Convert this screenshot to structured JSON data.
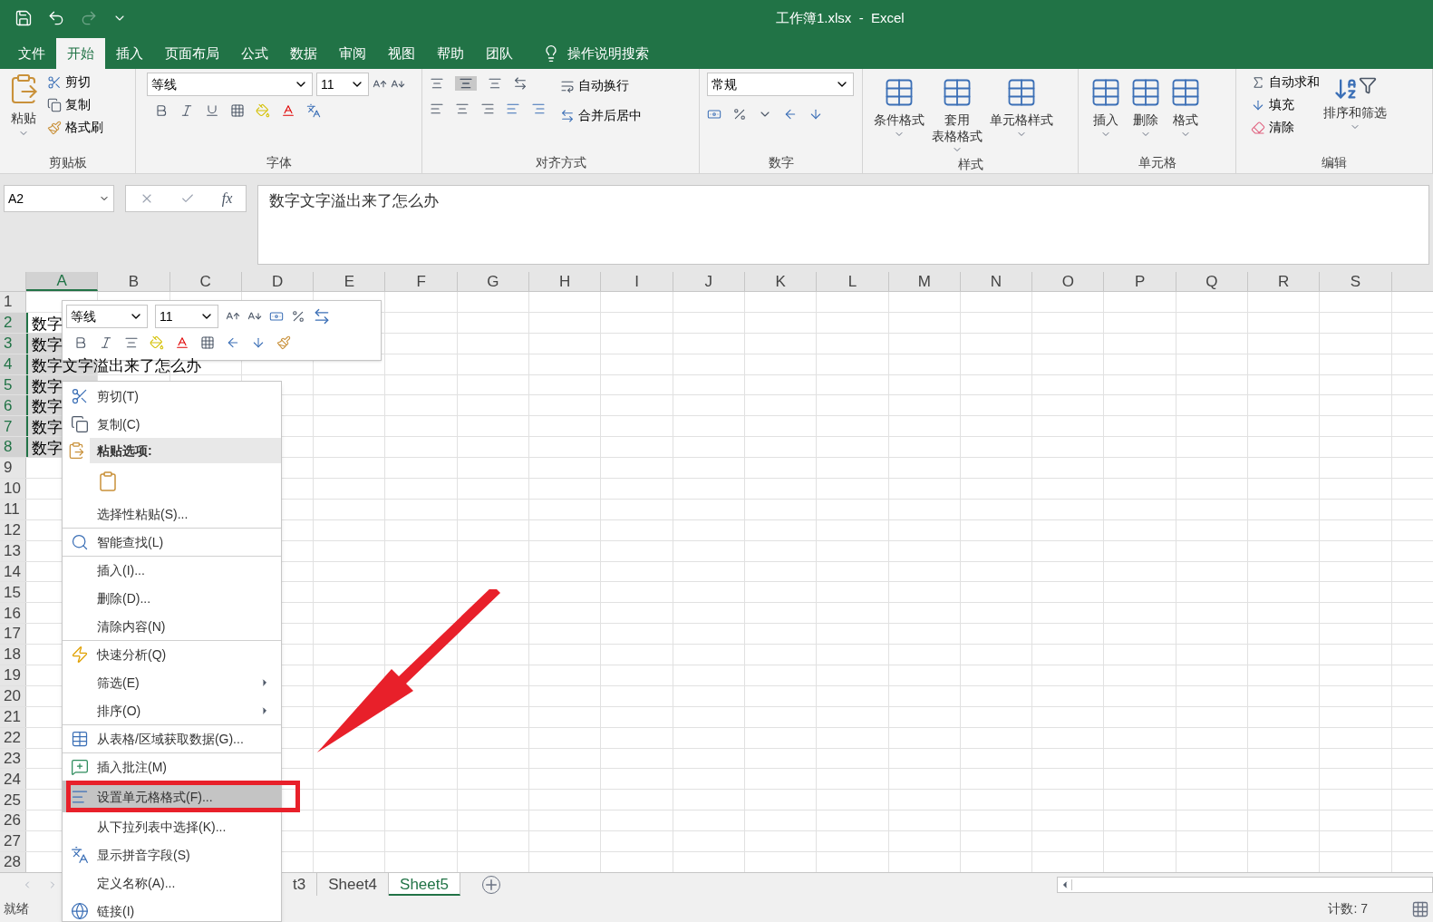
{
  "window": {
    "title": "工作簿1.xlsx  -  Excel"
  },
  "tabs": [
    {
      "label": "文件",
      "selected": false
    },
    {
      "label": "开始",
      "selected": true
    },
    {
      "label": "插入",
      "selected": false
    },
    {
      "label": "页面布局",
      "selected": false
    },
    {
      "label": "公式",
      "selected": false
    },
    {
      "label": "数据",
      "selected": false
    },
    {
      "label": "审阅",
      "selected": false
    },
    {
      "label": "视图",
      "selected": false
    },
    {
      "label": "帮助",
      "selected": false
    },
    {
      "label": "团队",
      "selected": false
    }
  ],
  "tell_me": {
    "placeholder": "操作说明搜索"
  },
  "ribbon": {
    "clipboard": {
      "paste": "粘贴",
      "cut": "剪切",
      "copy": "复制",
      "painter": "格式刷",
      "label": "剪贴板"
    },
    "font": {
      "name": "等线",
      "size": "11",
      "label": "字体"
    },
    "alignment": {
      "wrap": "自动换行",
      "merge": "合并后居中",
      "label": "对齐方式"
    },
    "number": {
      "format": "常规",
      "label": "数字"
    },
    "styles": {
      "items": [
        [
          "条件格式"
        ],
        [
          "套用",
          "表格格式"
        ],
        [
          "单元格样式"
        ]
      ],
      "label": "样式"
    },
    "cells": {
      "items": [
        "插入",
        "删除",
        "格式"
      ],
      "label": "单元格"
    },
    "editing": {
      "autosum": "自动求和",
      "fill": "填充",
      "clear": "清除",
      "sort": "排序和筛选",
      "label": "编辑"
    }
  },
  "formula_bar": {
    "name_box": "A2",
    "fx": "fx",
    "value": "数字文字溢出来了怎么办"
  },
  "grid": {
    "columns": [
      "A",
      "B",
      "C",
      "D",
      "E",
      "F",
      "G",
      "H",
      "I",
      "J",
      "K",
      "L",
      "M",
      "N",
      "O",
      "P",
      "Q",
      "R",
      "S"
    ],
    "rows": [
      {
        "label": "1"
      },
      {
        "label": "2",
        "a": "数字",
        "active": true
      },
      {
        "label": "3",
        "a": "数字",
        "active": false
      },
      {
        "label": "4",
        "a": "数字文字溢出来了怎么办",
        "active": false
      },
      {
        "label": "5",
        "a": "数字",
        "active": false
      },
      {
        "label": "6",
        "a": "数字",
        "active": false
      },
      {
        "label": "7",
        "a": "数字",
        "active": false
      },
      {
        "label": "8",
        "a": "数字",
        "active": false
      },
      {
        "label": "9"
      },
      {
        "label": "10"
      },
      {
        "label": "11"
      },
      {
        "label": "12"
      },
      {
        "label": "13"
      },
      {
        "label": "14"
      },
      {
        "label": "15"
      },
      {
        "label": "16"
      },
      {
        "label": "17"
      },
      {
        "label": "18"
      },
      {
        "label": "19"
      },
      {
        "label": "20"
      },
      {
        "label": "21"
      },
      {
        "label": "22"
      },
      {
        "label": "23"
      },
      {
        "label": "24"
      },
      {
        "label": "25"
      },
      {
        "label": "26"
      },
      {
        "label": "27"
      },
      {
        "label": "28"
      }
    ]
  },
  "mini_toolbar": {
    "font": "等线",
    "size": "11"
  },
  "context_menu": [
    {
      "label": "剪切(T)",
      "kind": "item",
      "selected": false,
      "submenu": false,
      "separator_before": false
    },
    {
      "label": "复制(C)",
      "kind": "item",
      "selected": false,
      "submenu": false,
      "separator_before": false
    },
    {
      "label": "粘贴选项:",
      "kind": "header"
    },
    {
      "kind": "paste_option"
    },
    {
      "label": "选择性粘贴(S)...",
      "kind": "item",
      "selected": false,
      "submenu": false,
      "separator_before": false
    },
    {
      "label": "智能查找(L)",
      "kind": "item",
      "selected": false,
      "submenu": false,
      "separator_before": true
    },
    {
      "label": "插入(I)...",
      "kind": "item",
      "selected": false,
      "submenu": false,
      "separator_before": true
    },
    {
      "label": "删除(D)...",
      "kind": "item",
      "selected": false,
      "submenu": false,
      "separator_before": false
    },
    {
      "label": "清除内容(N)",
      "kind": "item",
      "selected": false,
      "submenu": false,
      "separator_before": false
    },
    {
      "label": "快速分析(Q)",
      "kind": "item",
      "selected": false,
      "submenu": false,
      "separator_before": true
    },
    {
      "label": "筛选(E)",
      "kind": "item",
      "selected": false,
      "submenu": true,
      "separator_before": false
    },
    {
      "label": "排序(O)",
      "kind": "item",
      "selected": false,
      "submenu": true,
      "separator_before": false
    },
    {
      "label": "从表格/区域获取数据(G)...",
      "kind": "item",
      "selected": false,
      "submenu": false,
      "separator_before": true
    },
    {
      "label": "插入批注(M)",
      "kind": "item",
      "selected": false,
      "submenu": false,
      "separator_before": true
    },
    {
      "label": "设置单元格格式(F)...",
      "kind": "item",
      "selected": true,
      "submenu": false,
      "separator_before": false
    },
    {
      "label": "从下拉列表中选择(K)...",
      "kind": "item",
      "selected": false,
      "submenu": false,
      "separator_before": false
    },
    {
      "label": "显示拼音字段(S)",
      "kind": "item",
      "selected": false,
      "submenu": false,
      "separator_before": false
    },
    {
      "label": "定义名称(A)...",
      "kind": "item",
      "selected": false,
      "submenu": false,
      "separator_before": false
    },
    {
      "label": "链接(I)",
      "kind": "item",
      "selected": false,
      "submenu": false,
      "separator_before": false
    }
  ],
  "sheet_tabs": [
    {
      "label": "t3",
      "selected": false
    },
    {
      "label": "Sheet4",
      "selected": false
    },
    {
      "label": "Sheet5",
      "selected": true
    }
  ],
  "status_bar": {
    "mode": "就绪",
    "count": "计数: 7"
  }
}
